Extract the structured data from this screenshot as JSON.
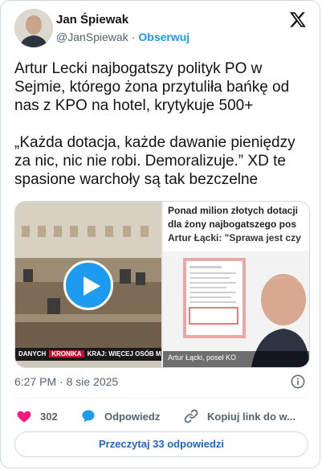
{
  "author": {
    "name": "Jan Śpiewak",
    "handle": "@JanSpiewak",
    "separator": "·",
    "follow_label": "Obserwuj"
  },
  "tweet": {
    "text": "Artur Lecki najbogatszy polityk PO w Sejmie, którego żona przytuliła bańkę od nas z KPO na hotel, krytykuje 500+\n\n„Każda dotacja, każde dawanie pieniędzy za nic, nic nie robi. Demoralizuje.” XD te spasione warchoły są tak bezczelne"
  },
  "media": {
    "video_ticker_left": "DANYCH",
    "video_ticker_badge": "KRONIKA",
    "video_ticker_right": "KRAJ: WIĘCEJ OSÓB MOŻE SKOR",
    "photo_headline_1": "Ponad milion złotych dotacji",
    "photo_headline_2": "dla żony najbogatszego pos",
    "photo_headline_3": "Artur Łącki: \"Sprawa jest czy",
    "photo_caption": "Artur Łącki, poseł KO"
  },
  "meta": {
    "time": "6:27 PM",
    "separator": "·",
    "date": "8 sie 2025"
  },
  "actions": {
    "like_count": "302",
    "reply_label": "Odpowiedz",
    "copy_link_label": "Kopiuj link do w..."
  },
  "read_replies_label": "Przeczytaj 33 odpowiedzi",
  "colors": {
    "accent": "#1d9bf0",
    "like": "#f91880",
    "text": "#0f1419",
    "secondary": "#536471",
    "border": "#cfd9de"
  }
}
